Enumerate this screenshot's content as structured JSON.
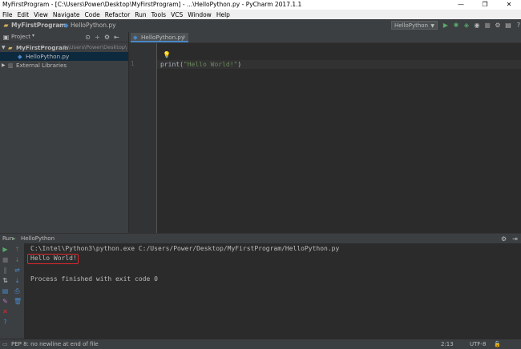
{
  "window": {
    "title": "MyFirstProgram - [C:\\Users\\Power\\Desktop\\MyFirstProgram] - ...\\HelloPython.py - PyCharm 2017.1.1",
    "minimize": "—",
    "restore": "❐",
    "close": "✕"
  },
  "menu": [
    "File",
    "Edit",
    "View",
    "Navigate",
    "Code",
    "Refactor",
    "Run",
    "Tools",
    "VCS",
    "Window",
    "Help"
  ],
  "navbar": {
    "project": "MyFirstProgram",
    "file": "HelloPython.py",
    "run_config": "HelloPython"
  },
  "project_panel": {
    "title": "Project",
    "root_name": "MyFirstProgram",
    "root_path": "C:\\Users\\Power\\Desktop\\",
    "file": "HelloPython.py",
    "external": "External Libraries"
  },
  "editor": {
    "tab": "HelloPython.py",
    "line_number": "1",
    "code_func": "print(",
    "code_string": "\"Hello World!\"",
    "code_close": ")"
  },
  "run_panel": {
    "label": "Run",
    "config": "HelloPython",
    "command": "C:\\Intel\\Python3\\python.exe C:/Users/Power/Desktop/MyFirstProgram/HelloPython.py",
    "output": "Hello World!",
    "finished": "Process finished with exit code 0"
  },
  "status": {
    "message": "PEP 8: no newline at end of file",
    "position": "2:13",
    "encoding": "UTF-8"
  },
  "colors": {
    "accent": "#4a88c7",
    "string": "#6a8759",
    "highlight_border": "#e0282d",
    "run_green": "#59a869"
  }
}
